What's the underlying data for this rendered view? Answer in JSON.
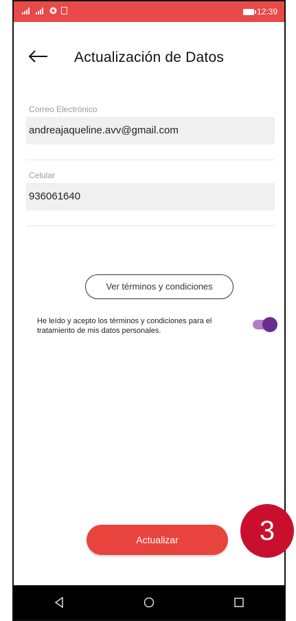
{
  "status_bar": {
    "time": "12:39",
    "bg_color": "#e84a4a"
  },
  "header": {
    "back_icon": "arrow-left-icon",
    "title": "Actualización de Datos"
  },
  "fields": {
    "email": {
      "label": "Correo Electrónico",
      "value": "andreajaqueline.avv@gmail.com"
    },
    "phone": {
      "label": "Celular",
      "value": "936061640"
    }
  },
  "terms": {
    "button_label": "Ver términos y condiciones",
    "consent_text": "He leído y acepto los términos y condiciones para el tratamiento de mis datos personales.",
    "toggle_on": true,
    "toggle_color": "#6a2c8e"
  },
  "actions": {
    "update_label": "Actualizar",
    "update_color": "#e8443d"
  },
  "nav": {
    "back_icon": "nav-back-icon",
    "home_icon": "nav-home-icon",
    "recents_icon": "nav-recents-icon"
  },
  "step_badge": {
    "number": "3",
    "color": "#c8102e"
  }
}
